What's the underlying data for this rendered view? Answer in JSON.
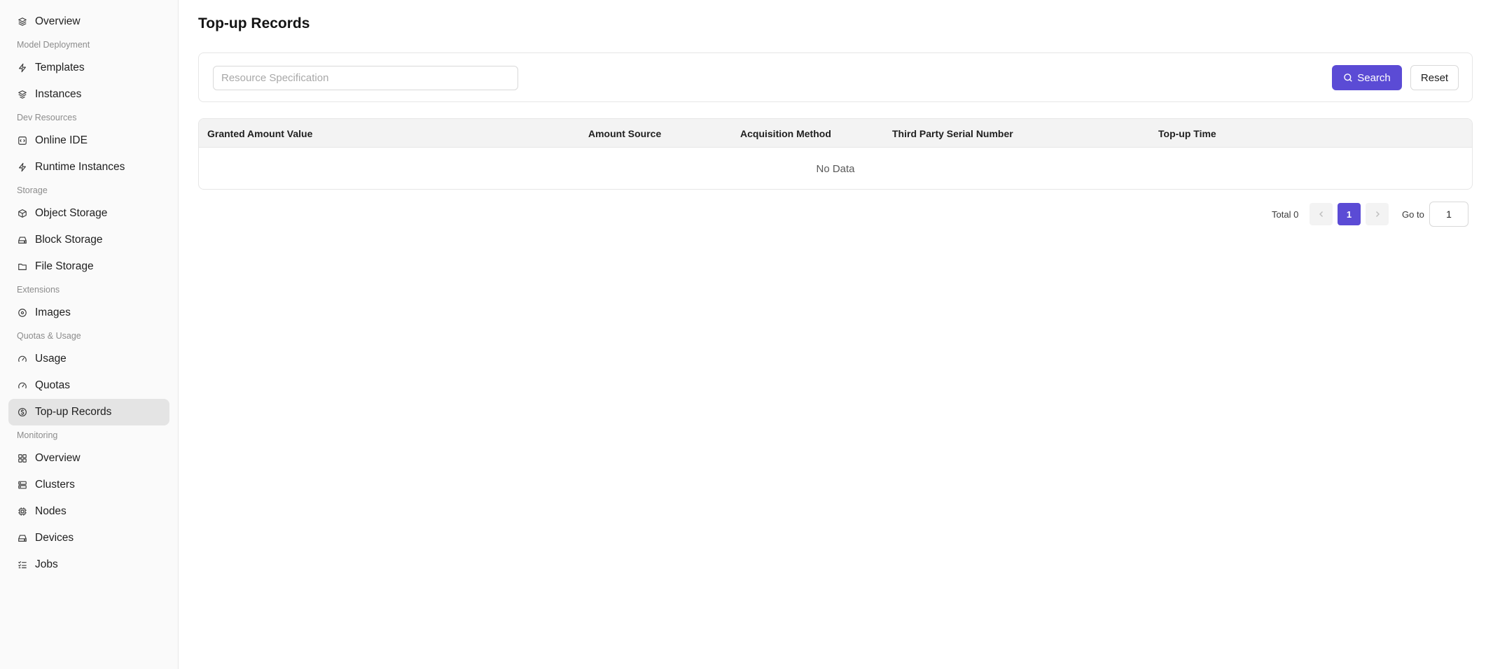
{
  "sidebar": {
    "items": [
      {
        "type": "item",
        "label": "Overview",
        "icon": "layers-icon"
      },
      {
        "type": "group",
        "label": "Model Deployment"
      },
      {
        "type": "item",
        "label": "Templates",
        "icon": "bolt-icon"
      },
      {
        "type": "item",
        "label": "Instances",
        "icon": "stack-icon"
      },
      {
        "type": "group",
        "label": "Dev Resources"
      },
      {
        "type": "item",
        "label": "Online IDE",
        "icon": "code-square-icon"
      },
      {
        "type": "item",
        "label": "Runtime Instances",
        "icon": "bolt-icon"
      },
      {
        "type": "group",
        "label": "Storage"
      },
      {
        "type": "item",
        "label": "Object Storage",
        "icon": "cube-icon"
      },
      {
        "type": "item",
        "label": "Block Storage",
        "icon": "drive-icon"
      },
      {
        "type": "item",
        "label": "File Storage",
        "icon": "folder-icon"
      },
      {
        "type": "group",
        "label": "Extensions"
      },
      {
        "type": "item",
        "label": "Images",
        "icon": "disc-icon"
      },
      {
        "type": "group",
        "label": "Quotas & Usage"
      },
      {
        "type": "item",
        "label": "Usage",
        "icon": "gauge-icon"
      },
      {
        "type": "item",
        "label": "Quotas",
        "icon": "gauge-icon"
      },
      {
        "type": "item",
        "label": "Top-up Records",
        "icon": "dollar-circle-icon",
        "active": true
      },
      {
        "type": "group",
        "label": "Monitoring"
      },
      {
        "type": "item",
        "label": "Overview",
        "icon": "dashboard-icon"
      },
      {
        "type": "item",
        "label": "Clusters",
        "icon": "server-icon"
      },
      {
        "type": "item",
        "label": "Nodes",
        "icon": "chip-icon"
      },
      {
        "type": "item",
        "label": "Devices",
        "icon": "drive-icon"
      },
      {
        "type": "item",
        "label": "Jobs",
        "icon": "list-check-icon"
      }
    ]
  },
  "page": {
    "title": "Top-up Records"
  },
  "filter": {
    "placeholder": "Resource Specification",
    "value": "",
    "search_label": "Search",
    "reset_label": "Reset"
  },
  "table": {
    "columns": [
      "Granted Amount Value",
      "Amount Source",
      "Acquisition Method",
      "Third Party Serial Number",
      "Top-up Time"
    ],
    "rows": [],
    "empty_text": "No Data"
  },
  "pagination": {
    "total_label": "Total 0",
    "current_page": "1",
    "goto_label": "Go to",
    "goto_value": "1"
  },
  "colors": {
    "accent": "#5b4bd5",
    "sidebar_bg": "#fafafa",
    "active_item_bg": "#e4e4e4"
  }
}
